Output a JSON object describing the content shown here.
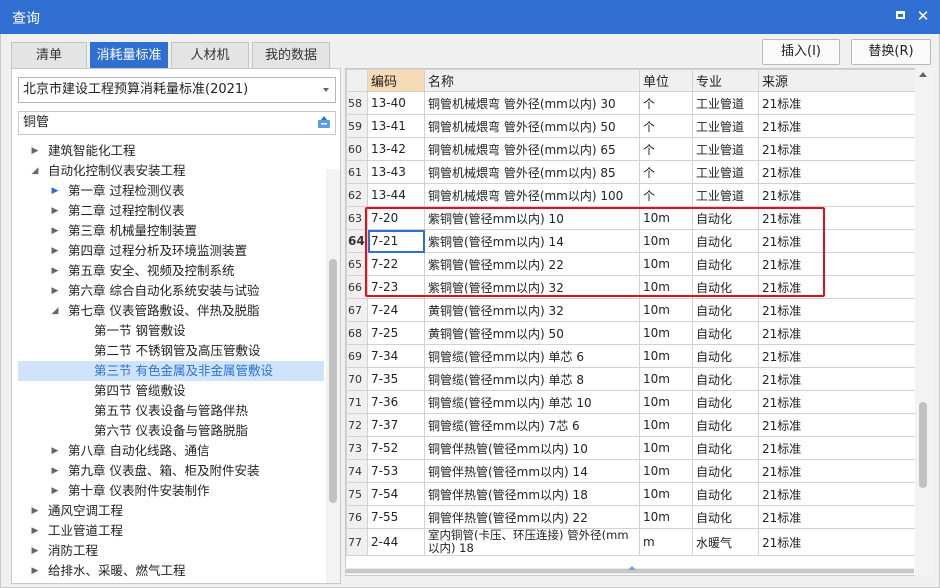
{
  "window": {
    "title": "查询"
  },
  "tabs": [
    {
      "label": "清单"
    },
    {
      "label": "消耗量标准",
      "active": true
    },
    {
      "label": "人材机"
    },
    {
      "label": "我的数据"
    }
  ],
  "actions": {
    "insert": "插入(I)",
    "replace": "替换(R)"
  },
  "standard_select": {
    "value": "北京市建设工程预算消耗量标准(2021)"
  },
  "search": {
    "value": "铜管"
  },
  "tree": [
    {
      "label": "建筑智能化工程",
      "level": 0,
      "expanded": false
    },
    {
      "label": "自动化控制仪表安装工程",
      "level": 0,
      "expanded": true
    },
    {
      "label": "第一章 过程检测仪表",
      "level": 1,
      "expanded": false,
      "highlighted": true
    },
    {
      "label": "第二章 过程控制仪表",
      "level": 1,
      "expanded": false
    },
    {
      "label": "第三章 机械量控制装置",
      "level": 1,
      "expanded": false
    },
    {
      "label": "第四章 过程分析及环境监测装置",
      "level": 1,
      "expanded": false
    },
    {
      "label": "第五章 安全、视频及控制系统",
      "level": 1,
      "expanded": false
    },
    {
      "label": "第六章 综合自动化系统安装与试验",
      "level": 1,
      "expanded": false
    },
    {
      "label": "第七章 仪表管路敷设、伴热及脱脂",
      "level": 1,
      "expanded": true
    },
    {
      "label": "第一节 钢管敷设",
      "level": 2
    },
    {
      "label": "第二节 不锈钢管及高压管敷设",
      "level": 2
    },
    {
      "label": "第三节 有色金属及非金属管敷设",
      "level": 2,
      "selected": true
    },
    {
      "label": "第四节 管缆敷设",
      "level": 2
    },
    {
      "label": "第五节 仪表设备与管路伴热",
      "level": 2
    },
    {
      "label": "第六节 仪表设备与管路脱脂",
      "level": 2
    },
    {
      "label": "第八章 自动化线路、通信",
      "level": 1,
      "expanded": false
    },
    {
      "label": "第九章 仪表盘、箱、柜及附件安装",
      "level": 1,
      "expanded": false
    },
    {
      "label": "第十章 仪表附件安装制作",
      "level": 1,
      "expanded": false
    },
    {
      "label": "通风空调工程",
      "level": 0,
      "expanded": false
    },
    {
      "label": "工业管道工程",
      "level": 0,
      "expanded": false
    },
    {
      "label": "消防工程",
      "level": 0,
      "expanded": false
    },
    {
      "label": "给排水、采暖、燃气工程",
      "level": 0,
      "expanded": false
    }
  ],
  "grid": {
    "columns": {
      "code": "编码",
      "name": "名称",
      "unit": "单位",
      "specialty": "专业",
      "source": "来源"
    },
    "rows": [
      {
        "n": "58",
        "code": "13-40",
        "name": "铜管机械煨弯 管外径(mm以内) 30",
        "unit": "个",
        "specialty": "工业管道",
        "source": "21标准"
      },
      {
        "n": "59",
        "code": "13-41",
        "name": "铜管机械煨弯 管外径(mm以内) 50",
        "unit": "个",
        "specialty": "工业管道",
        "source": "21标准"
      },
      {
        "n": "60",
        "code": "13-42",
        "name": "铜管机械煨弯 管外径(mm以内) 65",
        "unit": "个",
        "specialty": "工业管道",
        "source": "21标准"
      },
      {
        "n": "61",
        "code": "13-43",
        "name": "铜管机械煨弯 管外径(mm以内) 85",
        "unit": "个",
        "specialty": "工业管道",
        "source": "21标准"
      },
      {
        "n": "62",
        "code": "13-44",
        "name": "铜管机械煨弯 管外径(mm以内) 100",
        "unit": "个",
        "specialty": "工业管道",
        "source": "21标准"
      },
      {
        "n": "63",
        "code": "7-20",
        "name": "紫铜管(管径mm以内) 10",
        "unit": "10m",
        "specialty": "自动化",
        "source": "21标准"
      },
      {
        "n": "64",
        "code": "7-21",
        "name": "紫铜管(管径mm以内) 14",
        "unit": "10m",
        "specialty": "自动化",
        "source": "21标准",
        "current": true
      },
      {
        "n": "65",
        "code": "7-22",
        "name": "紫铜管(管径mm以内) 22",
        "unit": "10m",
        "specialty": "自动化",
        "source": "21标准"
      },
      {
        "n": "66",
        "code": "7-23",
        "name": "紫铜管(管径mm以内) 32",
        "unit": "10m",
        "specialty": "自动化",
        "source": "21标准"
      },
      {
        "n": "67",
        "code": "7-24",
        "name": "黄铜管(管径mm以内) 32",
        "unit": "10m",
        "specialty": "自动化",
        "source": "21标准"
      },
      {
        "n": "68",
        "code": "7-25",
        "name": "黄铜管(管径mm以内) 50",
        "unit": "10m",
        "specialty": "自动化",
        "source": "21标准"
      },
      {
        "n": "69",
        "code": "7-34",
        "name": "铜管缆(管径mm以内) 单芯 6",
        "unit": "10m",
        "specialty": "自动化",
        "source": "21标准"
      },
      {
        "n": "70",
        "code": "7-35",
        "name": "铜管缆(管径mm以内) 单芯 8",
        "unit": "10m",
        "specialty": "自动化",
        "source": "21标准"
      },
      {
        "n": "71",
        "code": "7-36",
        "name": "铜管缆(管径mm以内) 单芯 10",
        "unit": "10m",
        "specialty": "自动化",
        "source": "21标准"
      },
      {
        "n": "72",
        "code": "7-37",
        "name": "铜管缆(管径mm以内) 7芯 6",
        "unit": "10m",
        "specialty": "自动化",
        "source": "21标准"
      },
      {
        "n": "73",
        "code": "7-52",
        "name": "铜管伴热管(管径mm以内) 10",
        "unit": "10m",
        "specialty": "自动化",
        "source": "21标准"
      },
      {
        "n": "74",
        "code": "7-53",
        "name": "铜管伴热管(管径mm以内) 14",
        "unit": "10m",
        "specialty": "自动化",
        "source": "21标准"
      },
      {
        "n": "75",
        "code": "7-54",
        "name": "铜管伴热管(管径mm以内) 18",
        "unit": "10m",
        "specialty": "自动化",
        "source": "21标准"
      },
      {
        "n": "76",
        "code": "7-55",
        "name": "铜管伴热管(管径mm以内) 22",
        "unit": "10m",
        "specialty": "自动化",
        "source": "21标准"
      },
      {
        "n": "77",
        "code": "2-44",
        "name": "室内铜管(卡压、环压连接) 管外径(mm以内) 18",
        "unit": "m",
        "specialty": "水暖气",
        "source": "21标准",
        "wrap": true
      }
    ]
  },
  "colors": {
    "accent": "#2f6fd1",
    "highlight_box": "#e0101a",
    "code_header": "#f6d9b5",
    "selected_tree_bg": "#cfe3fb"
  },
  "icons": {
    "maximize": "maximize-icon",
    "close": "close-icon",
    "search": "filter-search-icon",
    "expand": "triangle-right-icon",
    "collapse": "triangle-down-icon"
  }
}
